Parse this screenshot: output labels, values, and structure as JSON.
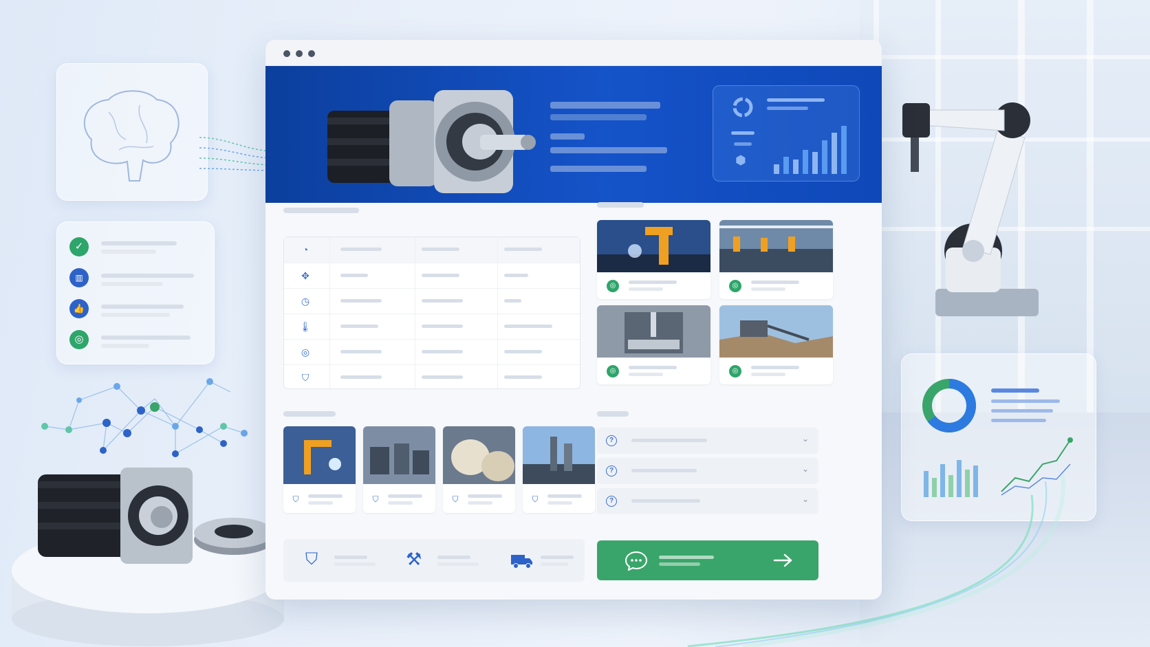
{
  "window": {
    "dots": 3
  },
  "hero": {
    "product": "planetary-gearbox-servo-motor",
    "accent": "#1553c9",
    "chart_bars": [
      0.2,
      0.35,
      0.3,
      0.5,
      0.45,
      0.7,
      0.85,
      1.0
    ]
  },
  "specs": {
    "icons": [
      "gauge-icon",
      "move-icon",
      "timer-icon",
      "thermometer-icon",
      "target-icon",
      "shield-icon"
    ],
    "rows": 6,
    "columns": 4
  },
  "applications": {
    "images": [
      "robot-welding",
      "production-line",
      "cnc-machining",
      "mining-site"
    ],
    "badge_color": "#2ea56a"
  },
  "industries": {
    "images": [
      "robot-arm",
      "packaging-line",
      "paper-rolls",
      "refinery"
    ]
  },
  "faq": {
    "items": 3
  },
  "cta": {
    "color": "#3aa56a",
    "icon": "chat-icon",
    "arrow": "arrow-right-icon"
  },
  "trust": {
    "icons": [
      "shield-icon",
      "tools-icon",
      "truck-icon"
    ]
  },
  "left_panel": {
    "icons": [
      "check-icon",
      "chart-icon",
      "thumbs-up-icon",
      "target-icon"
    ],
    "colors": [
      "#2ea56a",
      "#2d62c8",
      "#2d62c8",
      "#2ea56a"
    ]
  }
}
